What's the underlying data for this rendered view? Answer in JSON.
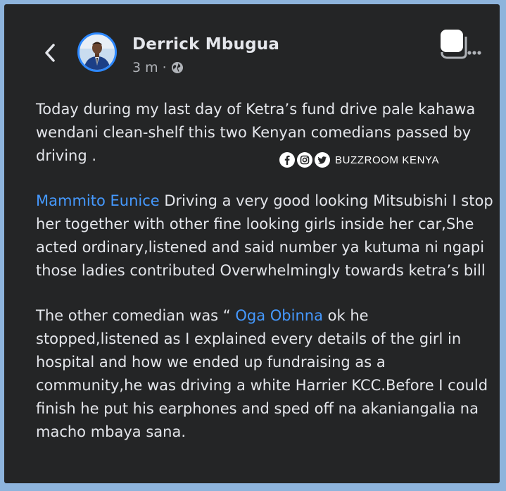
{
  "header": {
    "author_name": "Derrick Mbugua",
    "timestamp": "3 m",
    "separator": "·",
    "visibility_icon": "globe-icon",
    "back_icon": "chevron-left-icon",
    "more_icon": "more-options-icon"
  },
  "post": {
    "paragraph1": "Today during my last day of Ketra’s fund drive pale kahawa wendani clean-shelf this two Kenyan comedians passed by driving .",
    "paragraph2_mention": "Mammito Eunice",
    "paragraph2_text": " Driving a very good looking Mitsubishi I stop her together with other fine looking girls inside her car,She acted ordinary,listened and said number ya kutuma ni ngapi those ladies contributed Overwhelmingly towards ketra’s bill",
    "paragraph3_prefix": "The other comedian was “ ",
    "paragraph3_mention": "Oga Obinna",
    "paragraph3_text": "  ok he stopped,listened as I explained every details of the girl in hospital and how we ended up fundraising as a community,he was driving a white Harrier KCC.Before I could finish he put his earphones and sped off na akaniangalia na macho mbaya sana."
  },
  "watermark": {
    "text": "BUZZROOM KENYA",
    "icons": [
      "facebook-icon",
      "instagram-icon",
      "twitter-icon"
    ]
  },
  "colors": {
    "background": "#242526",
    "text": "#e4e6eb",
    "mention": "#4599ff",
    "secondary_text": "#b0b3b8",
    "frame": "#8eb4dc"
  }
}
